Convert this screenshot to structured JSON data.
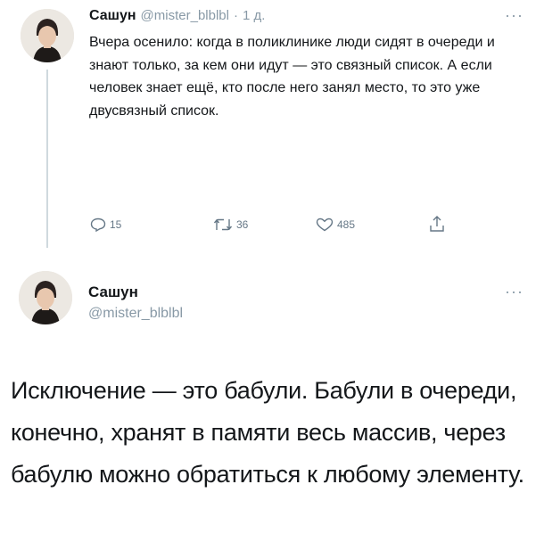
{
  "tweet1": {
    "name": "Сашун",
    "handle": "@mister_blblbl",
    "separator": "·",
    "time": "1 д.",
    "more": "···",
    "text": "Вчера осенило: когда в поликлинике люди сидят в очереди и знают только, за кем они идут — это связный список. А если человек знает ещё, кто после него занял место, то это уже двусвязный список.",
    "replies": "15",
    "retweets": "36",
    "likes": "485"
  },
  "tweet2": {
    "name": "Сашун",
    "handle": "@mister_blblbl",
    "more": "···",
    "text": "Исключение — это бабули. Бабули в очереди, конечно, хранят в памяти весь массив, через бабулю можно обратиться к любому элементу."
  },
  "colors": {
    "text": "#14171a",
    "secondary": "#657786",
    "thread_line": "#cfd9de"
  },
  "icons": {
    "reply": "reply-icon",
    "retweet": "retweet-icon",
    "like": "heart-icon",
    "share": "share-icon"
  }
}
